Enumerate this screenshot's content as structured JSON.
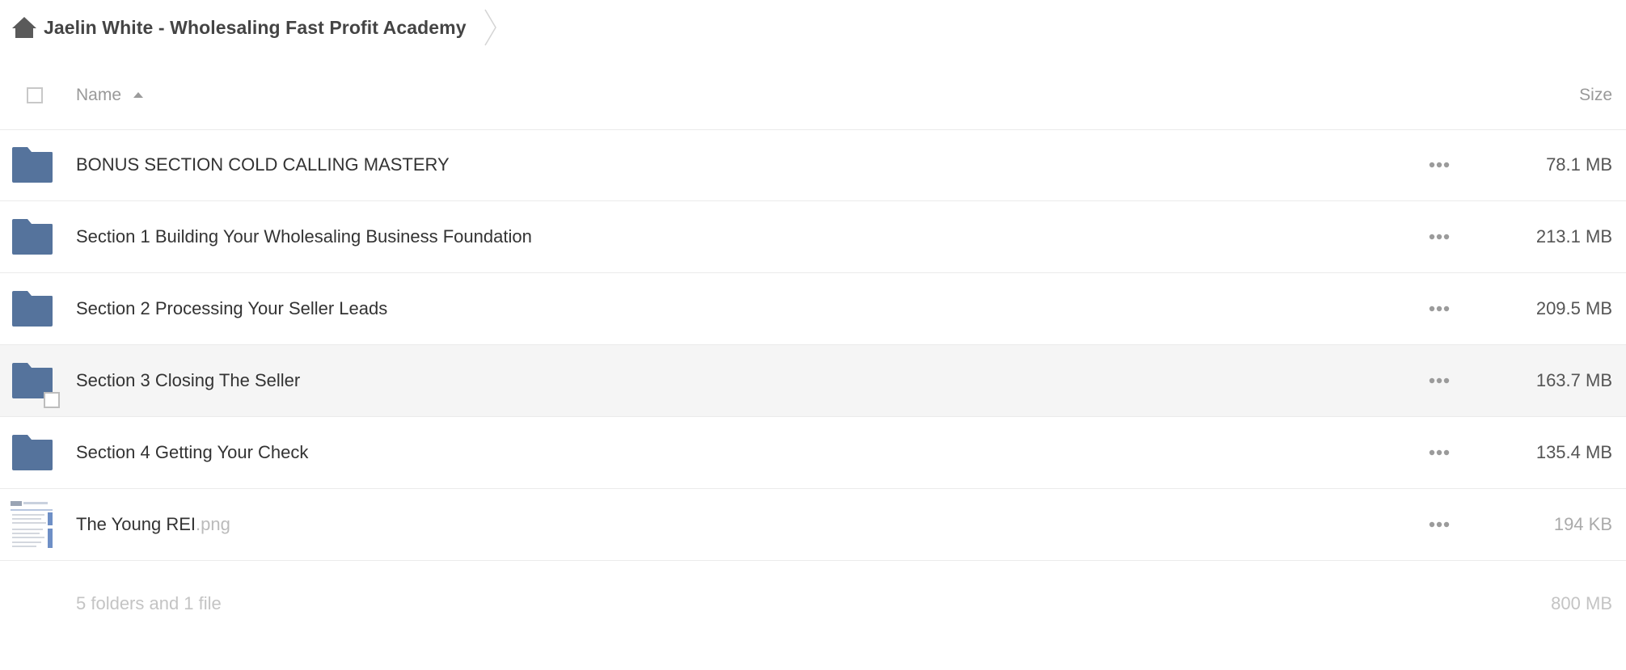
{
  "breadcrumb": {
    "home_icon": "home-icon",
    "folder_name": "Jaelin White - Wholesaling Fast Profit Academy"
  },
  "table": {
    "name_header": "Name",
    "sort_icon": "sort-ascending-icon",
    "size_header": "Size"
  },
  "rows": [
    {
      "name": "BONUS SECTION COLD CALLING MASTERY",
      "ext": "",
      "size": "78.1 MB",
      "type": "folder",
      "icon": "folder-icon"
    },
    {
      "name": "Section 1 Building Your Wholesaling Business Foundation",
      "ext": "",
      "size": "213.1 MB",
      "type": "folder",
      "icon": "folder-icon"
    },
    {
      "name": "Section 2 Processing Your Seller Leads",
      "ext": "",
      "size": "209.5 MB",
      "type": "folder",
      "icon": "folder-icon"
    },
    {
      "name": "Section 3 Closing The Seller",
      "ext": "",
      "size": "163.7 MB",
      "type": "folder",
      "icon": "folder-icon"
    },
    {
      "name": "Section 4 Getting Your Check",
      "ext": "",
      "size": "135.4 MB",
      "type": "folder",
      "icon": "folder-icon"
    },
    {
      "name": "The Young REI",
      "ext": ".png",
      "size": "194 KB",
      "type": "file",
      "icon": "image-thumbnail"
    }
  ],
  "row_menu_icon": "more-options-icon",
  "summary": {
    "count": "5 folders and 1 file",
    "total_size": "800 MB"
  },
  "colors": {
    "folder": "#55739c",
    "row_hover": "#f5f5f5",
    "divider": "#ebebeb"
  }
}
